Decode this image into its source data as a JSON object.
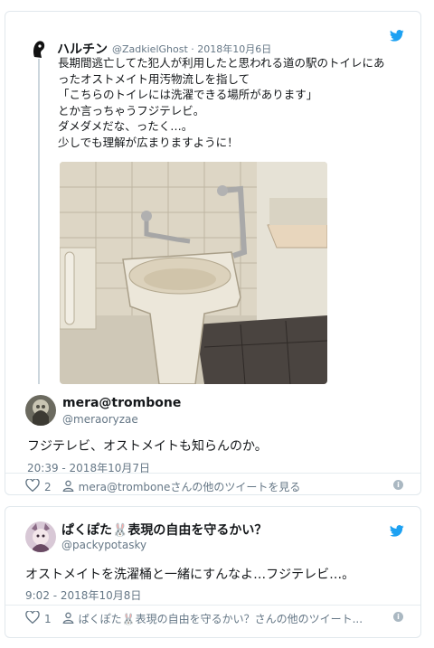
{
  "tweet1": {
    "quoted": {
      "name": "ハルチン",
      "handle_date": "@ZadkielGhost · 2018年10月6日",
      "lines": [
        "長期間逃亡してた犯人が利用したと思われる道の駅のトイレにあ",
        "ったオストメイト用汚物流しを指して",
        "「こちらのトイレには洗濯できる場所があります」",
        "とか言っちゃうフジテレビ。",
        "ダメダメだな、ったく…。",
        "少しでも理解が広まりますように！"
      ]
    },
    "name": "mera@trombone",
    "handle": "@meraoryzae",
    "text": "フジテレビ、オストメイトも知らんのか。",
    "time": "20:39 - 2018年10月7日",
    "likes": "2",
    "more_link": "mera@tromboneさんの他のツイートを見る"
  },
  "tweet2": {
    "name": "ぱくぽた🐰表現の自由を守るかい？",
    "handle": "@packypotasky",
    "text": "オストメイトを洗濯桶と一緒にすんなよ…フジテレビ…。",
    "time": "9:02 - 2018年10月8日",
    "likes": "1",
    "more_link": "ぱくぽた🐰表現の自由を守るかい？さんの他のツイート..."
  },
  "icons": {
    "brand": "twitter-bird",
    "like": "heart-outline",
    "profile": "person-outline",
    "info": "info-circle"
  },
  "colors": {
    "twitter_blue": "#1da1f2",
    "text": "#14171a",
    "muted": "#657786",
    "border": "#e1e8ed"
  }
}
